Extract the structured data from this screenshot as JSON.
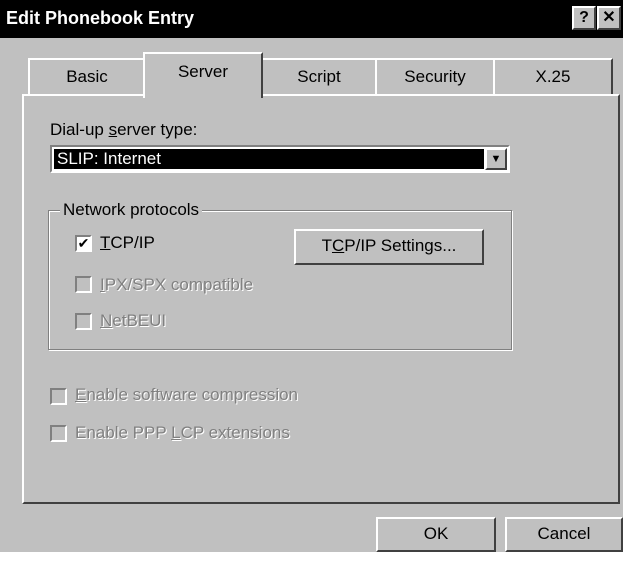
{
  "window": {
    "title": "Edit Phonebook Entry",
    "help_glyph": "?",
    "close_glyph": "✕"
  },
  "tabs": [
    {
      "label": "Basic",
      "active": false
    },
    {
      "label": "Server",
      "active": true
    },
    {
      "label": "Script",
      "active": false
    },
    {
      "label": "Security",
      "active": false
    },
    {
      "label": "X.25",
      "active": false
    }
  ],
  "server": {
    "type_label_pre": "Dial-up ",
    "type_label_u": "s",
    "type_label_post": "erver type:",
    "type_value": "SLIP: Internet",
    "dropdown_glyph": "▼"
  },
  "protocols": {
    "legend": "Network protocols",
    "tcpip": {
      "u": "T",
      "rest": "CP/IP",
      "checked": true,
      "mark": "✔"
    },
    "ipx": {
      "u": "I",
      "rest": "PX/SPX compatible",
      "checked": false,
      "disabled": true
    },
    "netbeui": {
      "u": "N",
      "rest": "etBEUI",
      "checked": false,
      "disabled": true
    },
    "settings_pre": "T",
    "settings_u": "C",
    "settings_post": "P/IP Settings..."
  },
  "options": {
    "compression": {
      "u": "E",
      "rest": "nable software compression",
      "checked": false,
      "disabled": true
    },
    "lcp": {
      "pre": "Enable PPP ",
      "u": "L",
      "rest": "CP extensions",
      "checked": false,
      "disabled": true
    }
  },
  "footer": {
    "ok_label": "OK",
    "cancel_label": "Cancel"
  }
}
